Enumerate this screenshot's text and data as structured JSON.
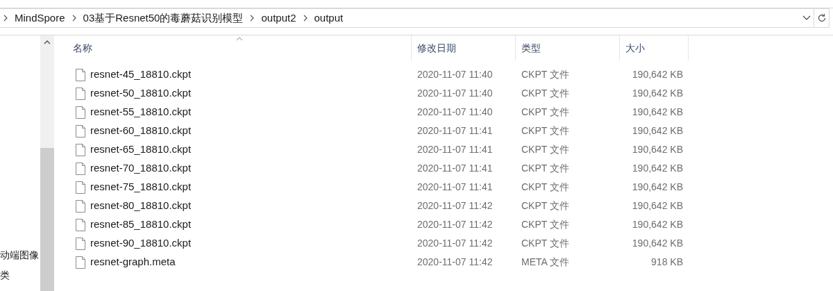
{
  "address_bar": {
    "crumbs": [
      "MindSpore",
      "03基于Resnet50的毒蘑菇识别模型",
      "output2",
      "output"
    ]
  },
  "nav_pane": {
    "items": [
      "动端图像",
      "类"
    ]
  },
  "table": {
    "columns": [
      "名称",
      "修改日期",
      "类型",
      "大小"
    ],
    "rows": [
      {
        "name": "resnet-45_18810.ckpt",
        "date": "2020-11-07 11:40",
        "type": "CKPT 文件",
        "size": "190,642 KB"
      },
      {
        "name": "resnet-50_18810.ckpt",
        "date": "2020-11-07 11:40",
        "type": "CKPT 文件",
        "size": "190,642 KB"
      },
      {
        "name": "resnet-55_18810.ckpt",
        "date": "2020-11-07 11:40",
        "type": "CKPT 文件",
        "size": "190,642 KB"
      },
      {
        "name": "resnet-60_18810.ckpt",
        "date": "2020-11-07 11:41",
        "type": "CKPT 文件",
        "size": "190,642 KB"
      },
      {
        "name": "resnet-65_18810.ckpt",
        "date": "2020-11-07 11:41",
        "type": "CKPT 文件",
        "size": "190,642 KB"
      },
      {
        "name": "resnet-70_18810.ckpt",
        "date": "2020-11-07 11:41",
        "type": "CKPT 文件",
        "size": "190,642 KB"
      },
      {
        "name": "resnet-75_18810.ckpt",
        "date": "2020-11-07 11:41",
        "type": "CKPT 文件",
        "size": "190,642 KB"
      },
      {
        "name": "resnet-80_18810.ckpt",
        "date": "2020-11-07 11:42",
        "type": "CKPT 文件",
        "size": "190,642 KB"
      },
      {
        "name": "resnet-85_18810.ckpt",
        "date": "2020-11-07 11:42",
        "type": "CKPT 文件",
        "size": "190,642 KB"
      },
      {
        "name": "resnet-90_18810.ckpt",
        "date": "2020-11-07 11:42",
        "type": "CKPT 文件",
        "size": "190,642 KB"
      },
      {
        "name": "resnet-graph.meta",
        "date": "2020-11-07 11:42",
        "type": "META 文件",
        "size": "918 KB"
      }
    ]
  }
}
